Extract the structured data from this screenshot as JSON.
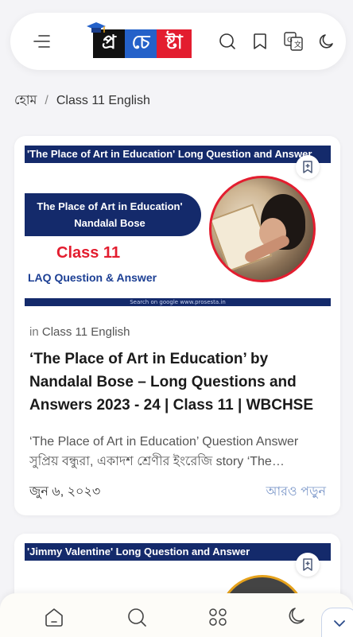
{
  "header": {
    "logo": {
      "letters": [
        "প্র",
        "চে",
        "ষ্টা"
      ]
    },
    "icons": {
      "menu": "menu-icon",
      "search": "search-icon",
      "bookmark": "bookmark-icon",
      "translate": "translate-icon",
      "dark_mode": "moon-icon"
    }
  },
  "breadcrumb": {
    "home": "হোম",
    "separator": "/",
    "current": "Class 11 English"
  },
  "posts": [
    {
      "thumbnail": {
        "banner": "'The Place of Art in Education' Long Question and Answer",
        "pill_line1": "The Place of Art in Education'",
        "pill_line2": "Nandalal Bose",
        "class_label": "Class 11",
        "laq_label": "LAQ Question & Answer",
        "footer": "Search on google  www.prosesta.in"
      },
      "category_prefix": "in",
      "category": "Class 11 English",
      "title": "‘The Place of Art in Education’ by Nandalal Bose – Long Questions and Answers 2023 - 24 | Class 11 | WBCHSE",
      "excerpt_line1": "‘The Place of Art in Education’ Question Answer",
      "excerpt_line2": "সুপ্রিয় বন্ধুরা, একাদশ শ্রেণীর ইংরেজি story ‘The…",
      "date": "জুন ৬, ২০২৩",
      "read_more": "আরও পড়ুন"
    },
    {
      "thumbnail": {
        "banner": "'Jimmy Valentine' Long Question and Answer"
      }
    }
  ],
  "bottom_nav": {
    "icons": [
      "home-icon",
      "search-icon",
      "apps-icon",
      "moon-icon"
    ]
  },
  "colors": {
    "navy": "#142a6b",
    "red": "#e31d2f",
    "blue": "#2461c9",
    "link": "#7b97c9"
  }
}
